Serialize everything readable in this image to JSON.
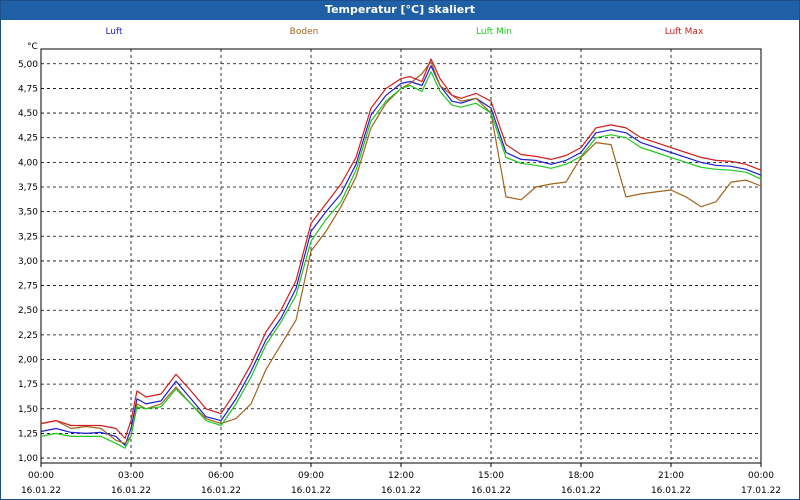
{
  "window": {
    "title": "Temperatur [°C] skaliert"
  },
  "chart_data": {
    "type": "line",
    "title": "Temperatur [°C] skaliert",
    "ylabel": "°C",
    "xlabel": "",
    "ylim": [
      0.95,
      5.15
    ],
    "xlim": [
      0,
      24
    ],
    "grid": true,
    "legend_position": "top",
    "yticks": [
      "1,00",
      "1,25",
      "1,50",
      "1,75",
      "2,00",
      "2,25",
      "2,50",
      "2,75",
      "3,00",
      "3,25",
      "3,50",
      "3,75",
      "4,00",
      "4,25",
      "4,50",
      "4,75",
      "5,00"
    ],
    "xticks": [
      {
        "time": "00:00",
        "date": "16.01.22"
      },
      {
        "time": "03:00",
        "date": "16.01.22"
      },
      {
        "time": "06:00",
        "date": "16.01.22"
      },
      {
        "time": "09:00",
        "date": "16.01.22"
      },
      {
        "time": "12:00",
        "date": "16.01.22"
      },
      {
        "time": "15:00",
        "date": "16.01.22"
      },
      {
        "time": "18:00",
        "date": "16.01.22"
      },
      {
        "time": "21:00",
        "date": "16.01.22"
      },
      {
        "time": "00:00",
        "date": "17.01.22"
      }
    ],
    "x": [
      0,
      0.5,
      1,
      1.5,
      2,
      2.5,
      2.8,
      3,
      3.2,
      3.5,
      4,
      4.5,
      5,
      5.5,
      6,
      6.5,
      7,
      7.5,
      8,
      8.5,
      9,
      9.5,
      10,
      10.5,
      11,
      11.5,
      12,
      12.3,
      12.7,
      13,
      13.3,
      13.7,
      14,
      14.5,
      15,
      15.5,
      16,
      16.5,
      17,
      17.5,
      18,
      18.5,
      19,
      19.5,
      20,
      20.5,
      21,
      21.5,
      22,
      22.5,
      23,
      23.5,
      24
    ],
    "series": [
      {
        "name": "Luft",
        "color": "#1e1ed2",
        "values": [
          1.27,
          1.3,
          1.26,
          1.25,
          1.26,
          1.22,
          1.13,
          1.3,
          1.6,
          1.55,
          1.58,
          1.78,
          1.6,
          1.42,
          1.38,
          1.6,
          1.88,
          2.2,
          2.42,
          2.72,
          3.3,
          3.5,
          3.68,
          3.98,
          4.48,
          4.68,
          4.8,
          4.82,
          4.78,
          4.98,
          4.78,
          4.62,
          4.6,
          4.65,
          4.55,
          4.1,
          4.03,
          4.02,
          3.98,
          4.02,
          4.1,
          4.3,
          4.33,
          4.3,
          4.2,
          4.15,
          4.1,
          4.05,
          4.0,
          3.97,
          3.96,
          3.93,
          3.87
        ]
      },
      {
        "name": "Boden",
        "color": "#a0641e",
        "values": [
          1.35,
          1.38,
          1.3,
          1.32,
          1.3,
          1.18,
          1.15,
          1.22,
          1.55,
          1.5,
          1.55,
          1.72,
          1.55,
          1.4,
          1.35,
          1.4,
          1.55,
          1.9,
          2.15,
          2.4,
          3.1,
          3.3,
          3.55,
          3.85,
          4.35,
          4.6,
          4.75,
          4.8,
          4.9,
          5.02,
          4.78,
          4.68,
          4.62,
          4.65,
          4.5,
          3.65,
          3.62,
          3.75,
          3.78,
          3.8,
          4.05,
          4.2,
          4.18,
          3.65,
          3.68,
          3.7,
          3.72,
          3.65,
          3.55,
          3.6,
          3.8,
          3.82,
          3.76
        ]
      },
      {
        "name": "Luft Min",
        "color": "#1ec81e",
        "values": [
          1.22,
          1.25,
          1.22,
          1.22,
          1.22,
          1.15,
          1.1,
          1.22,
          1.52,
          1.5,
          1.52,
          1.7,
          1.55,
          1.38,
          1.33,
          1.55,
          1.82,
          2.15,
          2.38,
          2.65,
          3.2,
          3.42,
          3.6,
          3.92,
          4.42,
          4.62,
          4.75,
          4.78,
          4.72,
          4.92,
          4.72,
          4.58,
          4.56,
          4.6,
          4.5,
          4.05,
          3.99,
          3.97,
          3.94,
          3.98,
          4.06,
          4.25,
          4.28,
          4.25,
          4.15,
          4.1,
          4.05,
          4.0,
          3.95,
          3.93,
          3.92,
          3.9,
          3.83
        ]
      },
      {
        "name": "Luft Max",
        "color": "#d21e1e",
        "values": [
          1.35,
          1.38,
          1.33,
          1.33,
          1.33,
          1.3,
          1.2,
          1.38,
          1.68,
          1.62,
          1.65,
          1.85,
          1.68,
          1.5,
          1.45,
          1.68,
          1.95,
          2.28,
          2.5,
          2.8,
          3.38,
          3.58,
          3.78,
          4.05,
          4.55,
          4.75,
          4.85,
          4.87,
          4.82,
          5.05,
          4.85,
          4.68,
          4.65,
          4.7,
          4.62,
          4.18,
          4.08,
          4.06,
          4.03,
          4.07,
          4.15,
          4.35,
          4.38,
          4.35,
          4.25,
          4.2,
          4.15,
          4.1,
          4.05,
          4.02,
          4.01,
          3.98,
          3.92
        ]
      }
    ]
  }
}
